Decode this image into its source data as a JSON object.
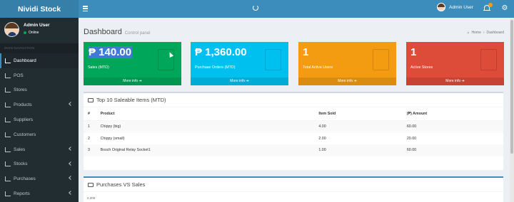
{
  "app": {
    "title": "Nividi Stock"
  },
  "header": {
    "user_name": "Admin User",
    "notification_count": "",
    "spinner": "loading-icon"
  },
  "sidebar": {
    "user": {
      "name": "Admin User",
      "status": "Online"
    },
    "nav_header": "MAIN NAVIGATION",
    "items": [
      {
        "label": "Dashboard",
        "icon": "dashboard-icon",
        "active": true
      },
      {
        "label": "POS",
        "icon": "cart-icon"
      },
      {
        "label": "Stores",
        "icon": "home-icon"
      },
      {
        "label": "Products",
        "icon": "box-icon",
        "expandable": true
      },
      {
        "label": "Suppliers",
        "icon": "truck-icon"
      },
      {
        "label": "Customers",
        "icon": "users-icon"
      },
      {
        "label": "Sales",
        "icon": "dollar-icon",
        "expandable": true
      },
      {
        "label": "Stocks",
        "icon": "database-icon",
        "expandable": true
      },
      {
        "label": "Purchases",
        "icon": "shopping-bag-icon",
        "expandable": true
      },
      {
        "label": "Reports",
        "icon": "file-icon",
        "expandable": true
      }
    ]
  },
  "page": {
    "title": "Dashboard",
    "subtitle": "Control panel",
    "breadcrumb": {
      "home": "Home",
      "current": "Dashboard"
    }
  },
  "stat_boxes": [
    {
      "value": "₱ 140.00",
      "label": "Sales (MTD)",
      "footer": "More info",
      "color": "#00a65a"
    },
    {
      "value": "₱ 1,360.00",
      "label": "Purchase Orders (MTD)",
      "footer": "More info",
      "color": "#00c0ef"
    },
    {
      "value": "1",
      "label": "Total Active Users",
      "footer": "More info",
      "color": "#f39c12"
    },
    {
      "value": "1",
      "label": "Active Stores",
      "footer": "More info",
      "color": "#dd4b39"
    }
  ],
  "top_items": {
    "title": "Top 10 Saleable Items (MTD)",
    "columns": [
      "#",
      "Product",
      "Item Sold",
      "(₱) Amount"
    ],
    "rows": [
      [
        "1",
        "Chippy (big)",
        "4.00",
        "60.00"
      ],
      [
        "2",
        "Chippy (small)",
        "2.00",
        "20.00"
      ],
      [
        "3",
        "Bosch Original Relay Socket1",
        "1.00",
        "60.00"
      ]
    ]
  },
  "purchases_vs_sales": {
    "title": "Purchases VS Sales",
    "first_tick": "2,000"
  },
  "colors": {
    "header": "#3c8dbc",
    "logo": "#367fa9",
    "sidebar": "#222d32"
  }
}
